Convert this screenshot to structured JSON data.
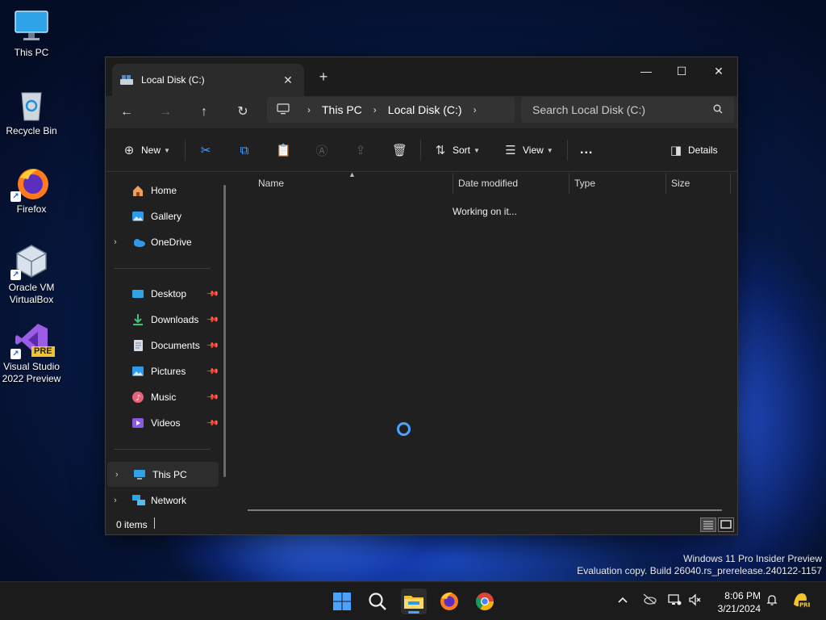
{
  "desktop": {
    "icons": [
      {
        "label": "This PC"
      },
      {
        "label": "Recycle Bin"
      },
      {
        "label": "Firefox"
      },
      {
        "label": "Oracle VM VirtualBox"
      },
      {
        "label": "Visual Studio 2022 Preview",
        "badge": "PRE"
      }
    ]
  },
  "explorer": {
    "tab_title": "Local Disk (C:)",
    "breadcrumb": [
      "This PC",
      "Local Disk (C:)"
    ],
    "search_placeholder": "Search Local Disk (C:)",
    "toolbar": {
      "new": "New",
      "sort": "Sort",
      "view": "View",
      "more": "...",
      "details": "Details"
    },
    "sidebar": {
      "home": "Home",
      "gallery": "Gallery",
      "onedrive": "OneDrive",
      "pinned": [
        "Desktop",
        "Downloads",
        "Documents",
        "Pictures",
        "Music",
        "Videos"
      ],
      "this_pc": "This PC",
      "network": "Network"
    },
    "columns": [
      "Name",
      "Date modified",
      "Type",
      "Size"
    ],
    "status_message": "Working on it...",
    "item_count": "0 items"
  },
  "watermark": {
    "line1": "Windows 11 Pro Insider Preview",
    "line2": "Evaluation copy. Build 26040.rs_prerelease.240122-1157"
  },
  "taskbar": {
    "time": "8:06 PM",
    "date": "3/21/2024",
    "colors": {
      "accent": "#4aa3ff",
      "folder": "#f4c430",
      "pre_badge": "#f4c430"
    }
  }
}
